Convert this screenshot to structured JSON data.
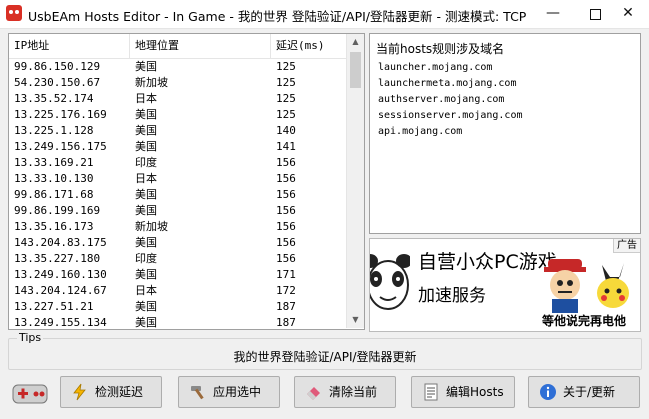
{
  "window": {
    "title": "UsbEAm Hosts Editor - In Game - 我的世界 登陆验证/API/登陆器更新 - 测速模式: TCP",
    "minimize_label": "—",
    "close_label": "✕"
  },
  "server_list": {
    "columns": [
      "IP地址",
      "地理位置",
      "延迟(ms)"
    ],
    "rows": [
      [
        "99.86.150.129",
        "美国",
        "125"
      ],
      [
        "54.230.150.67",
        "新加坡",
        "125"
      ],
      [
        "13.35.52.174",
        "日本",
        "125"
      ],
      [
        "13.225.176.169",
        "美国",
        "125"
      ],
      [
        "13.225.1.128",
        "美国",
        "140"
      ],
      [
        "13.249.156.175",
        "美国",
        "141"
      ],
      [
        "13.33.169.21",
        "印度",
        "156"
      ],
      [
        "13.33.10.130",
        "日本",
        "156"
      ],
      [
        "99.86.171.68",
        "美国",
        "156"
      ],
      [
        "99.86.199.169",
        "美国",
        "156"
      ],
      [
        "13.35.16.173",
        "新加坡",
        "156"
      ],
      [
        "143.204.83.175",
        "美国",
        "156"
      ],
      [
        "13.35.227.180",
        "印度",
        "156"
      ],
      [
        "13.249.160.130",
        "美国",
        "171"
      ],
      [
        "143.204.124.67",
        "日本",
        "172"
      ],
      [
        "13.227.51.21",
        "美国",
        "187"
      ],
      [
        "13.249.155.134",
        "美国",
        "187"
      ]
    ],
    "scroll_up_icon": "▲",
    "scroll_down_icon": "▼"
  },
  "domains_panel": {
    "header": "当前hosts规则涉及域名",
    "domains": [
      "launcher.mojang.com",
      "launchermeta.mojang.com",
      "authserver.mojang.com",
      "sessionserver.mojang.com",
      "api.mojang.com"
    ]
  },
  "ad": {
    "tag": "广告",
    "line1": "自营小众PC游戏",
    "line2": "加速服务",
    "caption": "等他说完再电他"
  },
  "tips": {
    "label": "Tips",
    "text": "我的世界登陆验证/API/登陆器更新"
  },
  "buttons": {
    "test_latency": "检测延迟",
    "apply_selected": "应用选中",
    "clear_current": "清除当前",
    "edit_hosts": "编辑Hosts",
    "about_update": "关于/更新"
  },
  "colors": {
    "accent_red": "#d93025",
    "panel_bg": "#ffffff",
    "window_bg": "#f0f0f0",
    "button_bg": "#e1e1e1"
  },
  "icons": {
    "app": "usbeam-app-icon",
    "gamepad": "gamepad-icon",
    "test_latency": "lightning-icon",
    "apply_selected": "hammer-icon",
    "clear_current": "eraser-icon",
    "edit_hosts": "document-icon",
    "about_update": "info-icon"
  }
}
